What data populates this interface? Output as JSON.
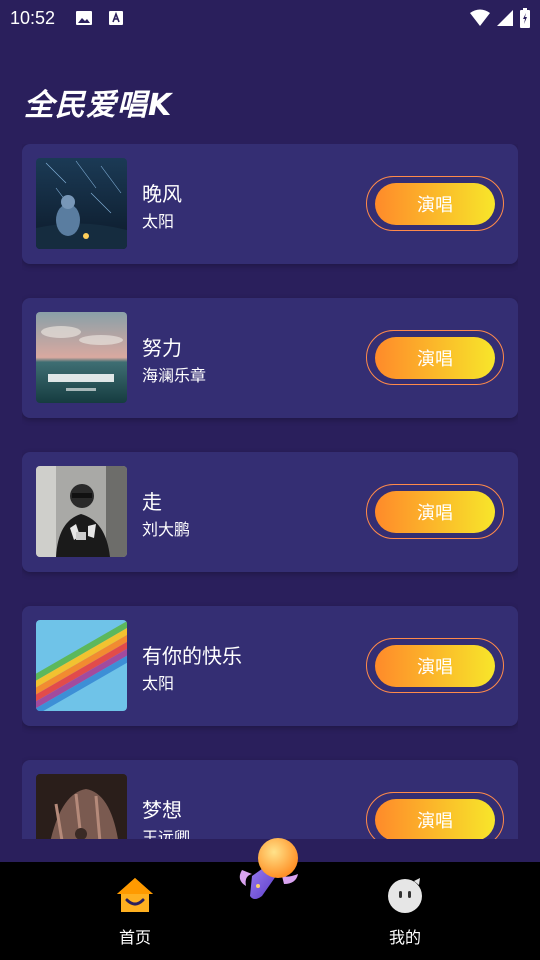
{
  "status_bar": {
    "time": "10:52"
  },
  "page": {
    "title": "全民爱唱K"
  },
  "songs": [
    {
      "title": "晚风",
      "artist": "太阳",
      "action": "演唱"
    },
    {
      "title": "努力",
      "artist": "海澜乐章",
      "action": "演唱"
    },
    {
      "title": "走",
      "artist": "刘大鹏",
      "action": "演唱"
    },
    {
      "title": "有你的快乐",
      "artist": "太阳",
      "action": "演唱"
    },
    {
      "title": "梦想",
      "artist": "王远卿",
      "action": "演唱"
    }
  ],
  "tab_bar": {
    "home_label": "首页",
    "mine_label": "我的"
  },
  "colors": {
    "background": "#2a1f5c",
    "card": "#342e73",
    "button_gradient_start": "#ff8a2a",
    "button_gradient_end": "#f7e62a",
    "tab_bar": "#000000"
  },
  "icons": [
    "image-icon",
    "text-icon",
    "wifi-icon",
    "signal-icon",
    "battery-icon",
    "home-icon",
    "microphone-icon",
    "profile-icon"
  ]
}
